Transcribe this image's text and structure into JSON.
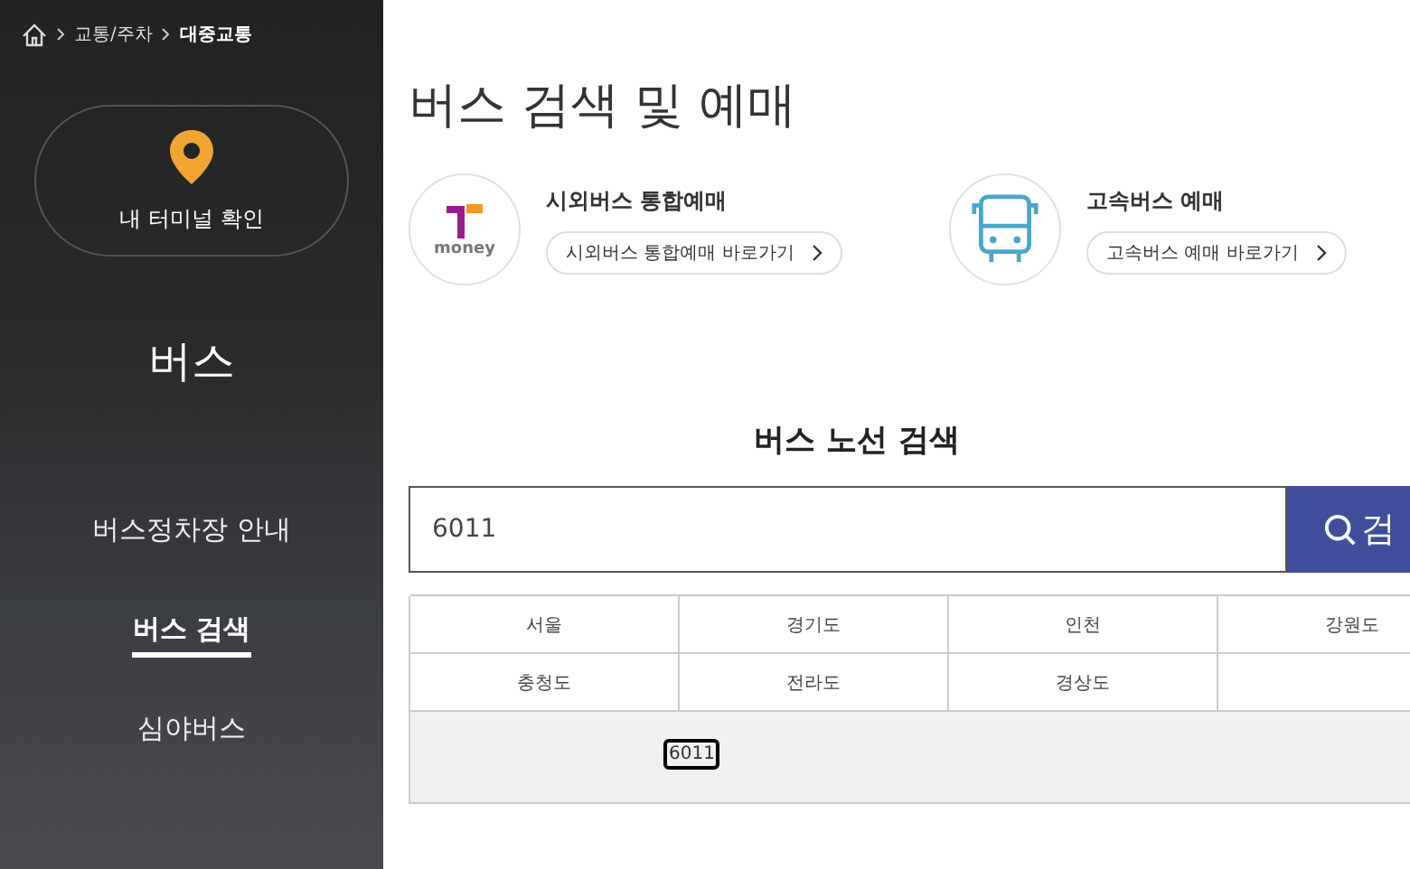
{
  "breadcrumb": [
    "교통/주차",
    "대중교통"
  ],
  "terminal_button": {
    "label": "내 터미널 확인"
  },
  "sidebar": {
    "title": "버스",
    "items": [
      {
        "label": "버스정차장 안내",
        "selected": false
      },
      {
        "label": "버스 검색",
        "selected": true
      },
      {
        "label": "심야버스",
        "selected": false
      }
    ]
  },
  "page_title": "버스 검색 및 예매",
  "services": [
    {
      "kind": "tmoney",
      "logo_text": "money",
      "title": "시외버스 통합예매",
      "link": "시외버스 통합예매 바로가기"
    },
    {
      "kind": "bus",
      "title": "고속버스 예매",
      "link": "고속버스 예매 바로가기"
    }
  ],
  "route_search": {
    "heading": "버스 노선 검색",
    "value": "6011",
    "button": "검"
  },
  "regions": [
    [
      "서울",
      "경기도",
      "인천",
      "강원도"
    ],
    [
      "충청도",
      "전라도",
      "경상도"
    ]
  ],
  "results": [
    "6011"
  ]
}
